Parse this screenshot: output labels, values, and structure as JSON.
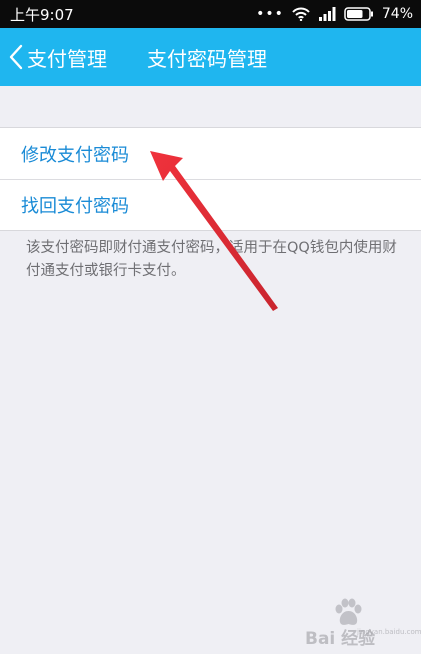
{
  "status_bar": {
    "time": "上午9:07",
    "dots": "•••",
    "battery_text": "74%",
    "battery_level": 0.74
  },
  "nav": {
    "back_label": "支付管理",
    "title": "支付密码管理"
  },
  "menu": {
    "items": [
      {
        "label": "修改支付密码"
      },
      {
        "label": "找回支付密码"
      }
    ]
  },
  "note": "该支付密码即财付通支付密码，适用于在QQ钱包内使用财付通支付或银行卡支付。",
  "watermark": {
    "brand": "Bai 经验",
    "sub": "jingyan.baidu.com"
  },
  "colors": {
    "nav_bg": "#1fb6ef",
    "link_text": "#1a8bd6",
    "page_bg": "#efeff4",
    "annotation_arrow": "#e8313a"
  },
  "icons": {
    "back": "chevron-left-icon",
    "wifi": "wifi-icon",
    "signal": "signal-icon",
    "battery": "battery-icon",
    "watermark": "paw-icon"
  }
}
